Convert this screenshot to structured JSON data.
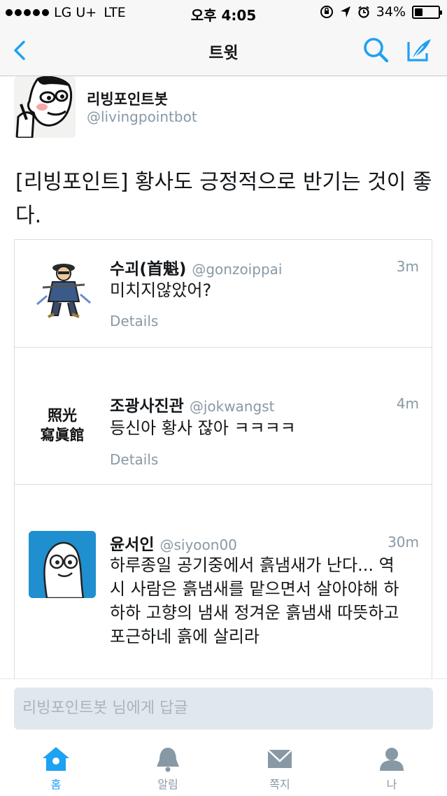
{
  "status_bar": {
    "carrier": "LG U+",
    "network": "LTE",
    "time": "오후 4:05",
    "battery_text": "34%",
    "battery_level": 0.34
  },
  "nav": {
    "title": "트윗",
    "back_icon": "chevron-left-icon",
    "search_icon": "search-icon",
    "compose_icon": "compose-feather-icon",
    "accent_color": "#1da1f2"
  },
  "tweet": {
    "author_name": "리빙포인트봇",
    "author_handle": "@livingpointbot",
    "text": "[리빙포인트] 황사도 긍정적으로 반기는 것이 좋다."
  },
  "replies": [
    {
      "name": "수괴(首魁)",
      "handle": "@gonzoippai",
      "time": "3m",
      "text": "미치지않았어?",
      "details": "Details"
    },
    {
      "name": "조광사진관",
      "handle": "@jokwangst",
      "time": "4m",
      "text": "등신아 황사 잖아 ㅋㅋㅋㅋ",
      "details": "Details",
      "avatar_text": "照光寫眞館"
    },
    {
      "name": "윤서인",
      "handle": "@siyoon00",
      "time": "30m",
      "text": "하루종일 공기중에서 흙냄새가 난다... 역시 사람은 흙냄새를 맡으면서 살아야해 하하하 고향의 냄새 정겨운 흙냄새 따뜻하고 포근하네 흙에 살리라"
    }
  ],
  "composer": {
    "placeholder": "리빙포인트봇 님에게 답글"
  },
  "tabs": [
    {
      "label": "홈",
      "icon": "home-icon",
      "active": true
    },
    {
      "label": "알림",
      "icon": "bell-icon",
      "active": false
    },
    {
      "label": "쪽지",
      "icon": "envelope-icon",
      "active": false
    },
    {
      "label": "나",
      "icon": "person-icon",
      "active": false
    }
  ]
}
